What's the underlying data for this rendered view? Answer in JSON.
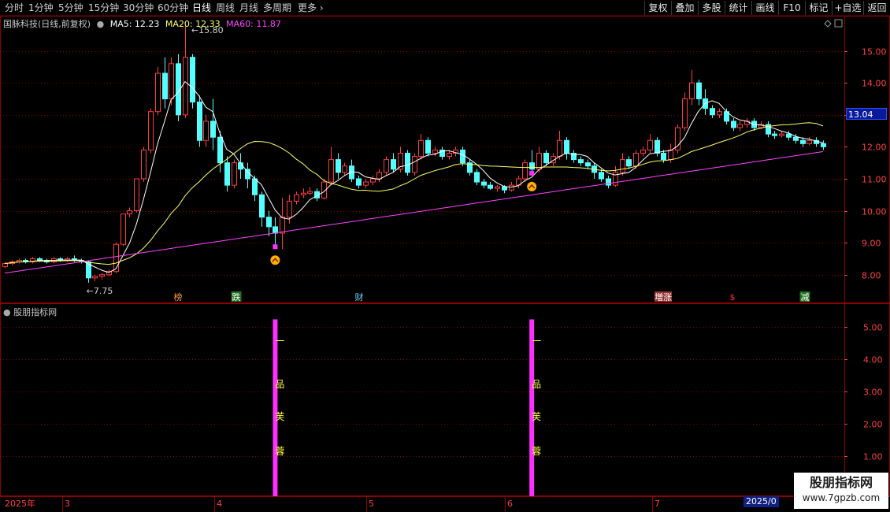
{
  "toolbar": {
    "timeframes": [
      "分时",
      "1分钟",
      "5分钟",
      "15分钟",
      "30分钟",
      "60分钟",
      "日线",
      "周线",
      "月线",
      "多周期",
      "更多"
    ],
    "active_index": 6,
    "right_buttons": [
      "复权",
      "叠加",
      "多股",
      "统计",
      "画线",
      "F10",
      "标记",
      "+自选",
      "返回"
    ]
  },
  "legend": {
    "stock_name": "国脉科技(日线,前复权)",
    "ma5_label": "MA5: 12.23",
    "ma20_label": "MA20: 12.33",
    "ma60_label": "MA60: 11.87"
  },
  "colors": {
    "up": "#ff3c3c",
    "down": "#54ffff",
    "ma5": "#ffffff",
    "ma20": "#ffff66",
    "ma60": "#ff44ff",
    "grid": "#8a0000",
    "axis_text": "#ff4040",
    "indicator_bar": "#ff30ff",
    "indicator_text": "#ffff40",
    "current_price_bg": "#0a1a9a"
  },
  "price_axis": {
    "labels": [
      "15.00",
      "14.00",
      "13.00",
      "12.00",
      "11.00",
      "10.00",
      "9.00",
      "8.00"
    ],
    "values": [
      15,
      14,
      13,
      12,
      11,
      10,
      9,
      8
    ],
    "current_price": "13.04"
  },
  "sub_axis": {
    "labels": [
      "5.00",
      "4.00",
      "3.00",
      "2.00",
      "1.00"
    ],
    "values": [
      5,
      4,
      3,
      2,
      1
    ]
  },
  "annotations": {
    "high_label": "15.80",
    "low_label": "7.75"
  },
  "event_markers": [
    {
      "label": "榜",
      "color": "#ff9a3c",
      "bg": "#000"
    },
    {
      "label": "跌",
      "color": "#ffffff",
      "bg": "#207020"
    },
    {
      "label": "财",
      "color": "#6ad0ff",
      "bg": "#000"
    },
    {
      "label": "増涨",
      "color": "#ffffff",
      "bg": "#903030"
    },
    {
      "label": "$",
      "color": "#ff3030",
      "bg": "#000"
    },
    {
      "label": "减",
      "color": "#ffffff",
      "bg": "#207020"
    }
  ],
  "sub_panel": {
    "title": "股朋指标网",
    "signal_text": [
      "一",
      "品",
      "芙",
      "蓉"
    ]
  },
  "bottom_axis": {
    "year": "2025年",
    "months": [
      "3",
      "4",
      "5",
      "6",
      "7"
    ],
    "date_tag": "2025/0"
  },
  "watermark": {
    "name": "股朋指标网",
    "url": "www.7gpzb.com"
  },
  "chart_data": {
    "type": "candlestick",
    "y_range": [
      7.6,
      16.0
    ],
    "candles": [
      [
        8.25,
        8.35,
        8.2,
        8.4
      ],
      [
        8.35,
        8.4,
        8.3,
        8.45
      ],
      [
        8.4,
        8.45,
        8.35,
        8.5
      ],
      [
        8.45,
        8.4,
        8.35,
        8.5
      ],
      [
        8.4,
        8.5,
        8.35,
        8.55
      ],
      [
        8.5,
        8.45,
        8.4,
        8.55
      ],
      [
        8.45,
        8.4,
        8.35,
        8.5
      ],
      [
        8.4,
        8.5,
        8.35,
        8.55
      ],
      [
        8.5,
        8.45,
        8.4,
        8.55
      ],
      [
        8.45,
        8.5,
        8.4,
        8.55
      ],
      [
        8.5,
        8.45,
        8.4,
        8.6
      ],
      [
        8.45,
        8.4,
        8.35,
        8.5
      ],
      [
        8.4,
        7.9,
        7.75,
        8.45
      ],
      [
        7.9,
        7.95,
        7.8,
        8.0
      ],
      [
        7.95,
        8.0,
        7.85,
        8.05
      ],
      [
        8.0,
        8.1,
        7.95,
        8.15
      ],
      [
        8.1,
        8.95,
        8.05,
        9.0
      ],
      [
        8.95,
        9.9,
        8.9,
        9.9
      ],
      [
        9.9,
        10.0,
        9.8,
        10.1
      ],
      [
        10.0,
        11.0,
        9.95,
        11.0
      ],
      [
        11.0,
        11.9,
        10.9,
        12.0
      ],
      [
        11.9,
        13.1,
        11.8,
        13.2
      ],
      [
        13.1,
        14.3,
        13.0,
        14.5
      ],
      [
        14.3,
        13.5,
        13.2,
        14.8
      ],
      [
        13.5,
        14.6,
        13.3,
        14.8
      ],
      [
        14.6,
        13.0,
        12.8,
        14.9
      ],
      [
        13.0,
        14.8,
        12.9,
        15.8
      ],
      [
        14.8,
        13.4,
        13.2,
        14.9
      ],
      [
        13.4,
        12.2,
        12.0,
        13.6
      ],
      [
        12.2,
        12.8,
        12.0,
        13.0
      ],
      [
        12.8,
        12.3,
        11.9,
        13.5
      ],
      [
        12.3,
        11.5,
        11.2,
        12.5
      ],
      [
        11.5,
        10.8,
        10.6,
        11.7
      ],
      [
        10.8,
        11.5,
        10.7,
        11.6
      ],
      [
        11.5,
        11.3,
        11.0,
        11.8
      ],
      [
        11.3,
        11.0,
        10.7,
        11.5
      ],
      [
        11.0,
        10.5,
        10.3,
        11.1
      ],
      [
        10.5,
        9.8,
        9.5,
        10.6
      ],
      [
        9.8,
        9.5,
        9.2,
        10.0
      ],
      [
        9.5,
        9.3,
        8.9,
        9.8
      ],
      [
        9.3,
        9.8,
        8.8,
        10.4
      ],
      [
        9.8,
        10.3,
        9.6,
        10.5
      ],
      [
        10.3,
        10.5,
        10.2,
        10.6
      ],
      [
        10.5,
        10.55,
        10.4,
        10.7
      ],
      [
        10.55,
        10.6,
        10.5,
        10.75
      ],
      [
        10.6,
        10.4,
        10.3,
        10.7
      ],
      [
        10.4,
        10.9,
        10.35,
        11.0
      ],
      [
        10.9,
        11.6,
        10.8,
        12.0
      ],
      [
        11.6,
        11.2,
        11.0,
        11.8
      ],
      [
        11.2,
        11.4,
        11.1,
        11.5
      ],
      [
        11.4,
        11.0,
        10.9,
        11.6
      ],
      [
        11.0,
        10.8,
        10.7,
        11.1
      ],
      [
        10.8,
        10.9,
        10.7,
        11.0
      ],
      [
        10.9,
        11.0,
        10.8,
        11.1
      ],
      [
        11.0,
        11.2,
        10.9,
        11.3
      ],
      [
        11.2,
        11.6,
        11.1,
        11.7
      ],
      [
        11.6,
        11.3,
        11.2,
        11.8
      ],
      [
        11.3,
        11.8,
        11.2,
        12.0
      ],
      [
        11.8,
        11.2,
        11.1,
        11.9
      ],
      [
        11.2,
        11.7,
        11.1,
        11.8
      ],
      [
        11.7,
        12.2,
        11.6,
        12.4
      ],
      [
        12.2,
        11.8,
        11.7,
        12.3
      ],
      [
        11.8,
        11.9,
        11.7,
        12.0
      ],
      [
        11.9,
        11.7,
        11.6,
        12.0
      ],
      [
        11.7,
        11.8,
        11.6,
        11.9
      ],
      [
        11.8,
        11.9,
        11.7,
        12.0
      ],
      [
        11.9,
        11.5,
        11.4,
        12.0
      ],
      [
        11.5,
        11.2,
        11.1,
        11.6
      ],
      [
        11.2,
        10.9,
        10.8,
        11.3
      ],
      [
        10.9,
        10.8,
        10.7,
        11.0
      ],
      [
        10.8,
        10.7,
        10.65,
        10.9
      ],
      [
        10.7,
        10.75,
        10.6,
        10.8
      ],
      [
        10.75,
        10.65,
        10.55,
        10.8
      ],
      [
        10.65,
        10.8,
        10.6,
        10.9
      ],
      [
        10.8,
        11.0,
        10.7,
        11.1
      ],
      [
        11.0,
        11.5,
        10.9,
        11.6
      ],
      [
        11.5,
        11.3,
        11.2,
        11.9
      ],
      [
        11.3,
        11.8,
        11.2,
        12.0
      ],
      [
        11.8,
        11.5,
        11.4,
        11.9
      ],
      [
        11.5,
        11.7,
        11.4,
        11.8
      ],
      [
        11.7,
        12.2,
        11.6,
        12.5
      ],
      [
        12.2,
        11.8,
        11.6,
        12.3
      ],
      [
        11.8,
        11.6,
        11.5,
        11.9
      ],
      [
        11.6,
        11.5,
        11.4,
        11.7
      ],
      [
        11.5,
        11.4,
        11.3,
        11.6
      ],
      [
        11.4,
        11.2,
        11.0,
        11.5
      ],
      [
        11.2,
        11.0,
        10.9,
        11.3
      ],
      [
        11.0,
        10.8,
        10.7,
        11.1
      ],
      [
        10.8,
        11.2,
        10.75,
        11.4
      ],
      [
        11.2,
        11.6,
        11.1,
        11.8
      ],
      [
        11.6,
        11.4,
        11.3,
        11.7
      ],
      [
        11.4,
        11.8,
        11.3,
        11.9
      ],
      [
        11.8,
        11.9,
        11.7,
        12.0
      ],
      [
        11.9,
        12.2,
        11.8,
        12.4
      ],
      [
        12.2,
        11.8,
        11.7,
        12.3
      ],
      [
        11.8,
        11.6,
        11.5,
        11.9
      ],
      [
        11.6,
        11.9,
        11.5,
        12.1
      ],
      [
        11.9,
        12.6,
        11.8,
        12.7
      ],
      [
        12.6,
        13.5,
        12.5,
        13.7
      ],
      [
        13.5,
        14.0,
        13.3,
        14.4
      ],
      [
        14.0,
        13.5,
        13.3,
        14.1
      ],
      [
        13.5,
        13.2,
        13.0,
        13.8
      ],
      [
        13.2,
        13.0,
        12.9,
        13.3
      ],
      [
        13.0,
        13.1,
        12.9,
        13.2
      ],
      [
        13.1,
        12.8,
        12.7,
        13.2
      ],
      [
        12.8,
        12.6,
        12.5,
        12.9
      ],
      [
        12.6,
        12.7,
        12.5,
        12.8
      ],
      [
        12.7,
        12.8,
        12.6,
        12.9
      ],
      [
        12.8,
        12.6,
        12.5,
        12.9
      ],
      [
        12.6,
        12.7,
        12.55,
        12.8
      ],
      [
        12.7,
        12.4,
        12.3,
        12.8
      ],
      [
        12.4,
        12.35,
        12.25,
        12.5
      ],
      [
        12.35,
        12.4,
        12.3,
        12.5
      ],
      [
        12.4,
        12.3,
        12.2,
        12.5
      ],
      [
        12.3,
        12.2,
        12.1,
        12.4
      ],
      [
        12.2,
        12.1,
        12.0,
        12.3
      ],
      [
        12.1,
        12.2,
        12.05,
        12.3
      ],
      [
        12.2,
        12.1,
        12.0,
        12.3
      ],
      [
        12.1,
        12.0,
        11.9,
        12.2
      ]
    ],
    "signal_indices": [
      39,
      76
    ],
    "signal_value": 5.0,
    "sub_y_range": [
      0,
      5.5
    ]
  }
}
